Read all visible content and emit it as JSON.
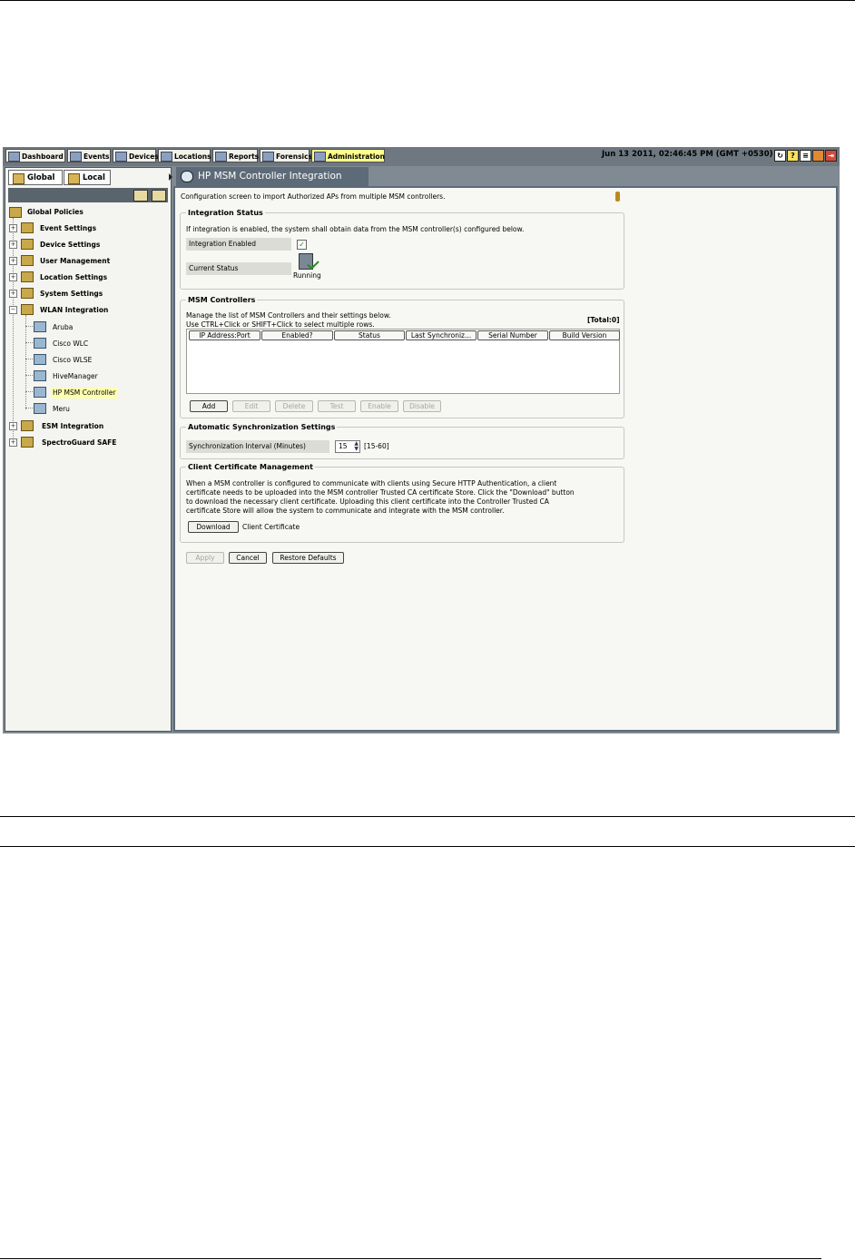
{
  "nav": {
    "items": [
      {
        "label": "Dashboard",
        "icon": "dashboard-icon"
      },
      {
        "label": "Events",
        "icon": "events-icon"
      },
      {
        "label": "Devices",
        "icon": "devices-icon"
      },
      {
        "label": "Locations",
        "icon": "locations-icon"
      },
      {
        "label": "Reports",
        "icon": "reports-icon"
      },
      {
        "label": "Forensics",
        "icon": "forensics-icon"
      },
      {
        "label": "Administration",
        "icon": "administration-icon",
        "active": true
      }
    ],
    "datetime": "Jun 13 2011, 02:46:45 PM (GMT +0530)"
  },
  "left": {
    "tabs": [
      {
        "label": "Global"
      },
      {
        "label": "Local"
      }
    ],
    "tree": {
      "root": "Global Policies",
      "items": [
        "Event Settings",
        "Device Settings",
        "User Management",
        "Location Settings",
        "System Settings",
        "WLAN Integration"
      ],
      "wlan_children": [
        "Aruba",
        "Cisco WLC",
        "Cisco WLSE",
        "HiveManager",
        "HP MSM Controller",
        "Meru"
      ],
      "after_items": [
        "ESM Integration",
        "SpectroGuard SAFE"
      ]
    }
  },
  "main": {
    "tab_title": "HP MSM Controller Integration",
    "intro": "Configuration screen to import Authorized APs from multiple MSM controllers.",
    "integration_status": {
      "legend": "Integration Status",
      "description": "If integration is enabled, the system shall obtain data from the MSM controller(s) configured below.",
      "enabled_label": "Integration Enabled",
      "enabled_mark": "✓",
      "status_label": "Current Status",
      "status_value": "Running"
    },
    "msm_controllers": {
      "legend": "MSM Controllers",
      "line1": "Manage the list of MSM Controllers and their settings below.",
      "line2": "Use CTRL+Click or SHIFT+Click to select multiple rows.",
      "total": "[Total:0]",
      "columns": [
        "IP Address:Port",
        "Enabled?",
        "Status",
        "Last Synchroniz...",
        "Serial Number",
        "Build Version"
      ],
      "buttons": {
        "add": "Add",
        "edit": "Edit",
        "delete": "Delete",
        "test": "Test",
        "enable": "Enable",
        "disable": "Disable"
      }
    },
    "auto_sync": {
      "legend": "Automatic Synchronization Settings",
      "interval_label": "Synchronization Interval (Minutes)",
      "interval_value": "15",
      "range": "[15-60]"
    },
    "cert": {
      "legend": "Client Certificate Management",
      "line1": "When a MSM controller is configured to communicate with clients using Secure HTTP Authentication, a client",
      "line2": "certificate needs to be uploaded into the MSM controller Trusted CA certificate Store. Click the \"Download\" button",
      "line3": "to download the necessary client certificate. Uploading this client certificate into the Controller Trusted CA",
      "line4": "certificate Store will allow the system to communicate and integrate with the MSM controller.",
      "download": "Download",
      "download_desc": "Client Certificate"
    },
    "footer_buttons": {
      "apply": "Apply",
      "cancel": "Cancel",
      "restore": "Restore Defaults"
    }
  },
  "colors": {
    "accent_tab": "#5d6b78",
    "active_nav": "#ffff8c",
    "selected_tree": "#ffffb0"
  }
}
